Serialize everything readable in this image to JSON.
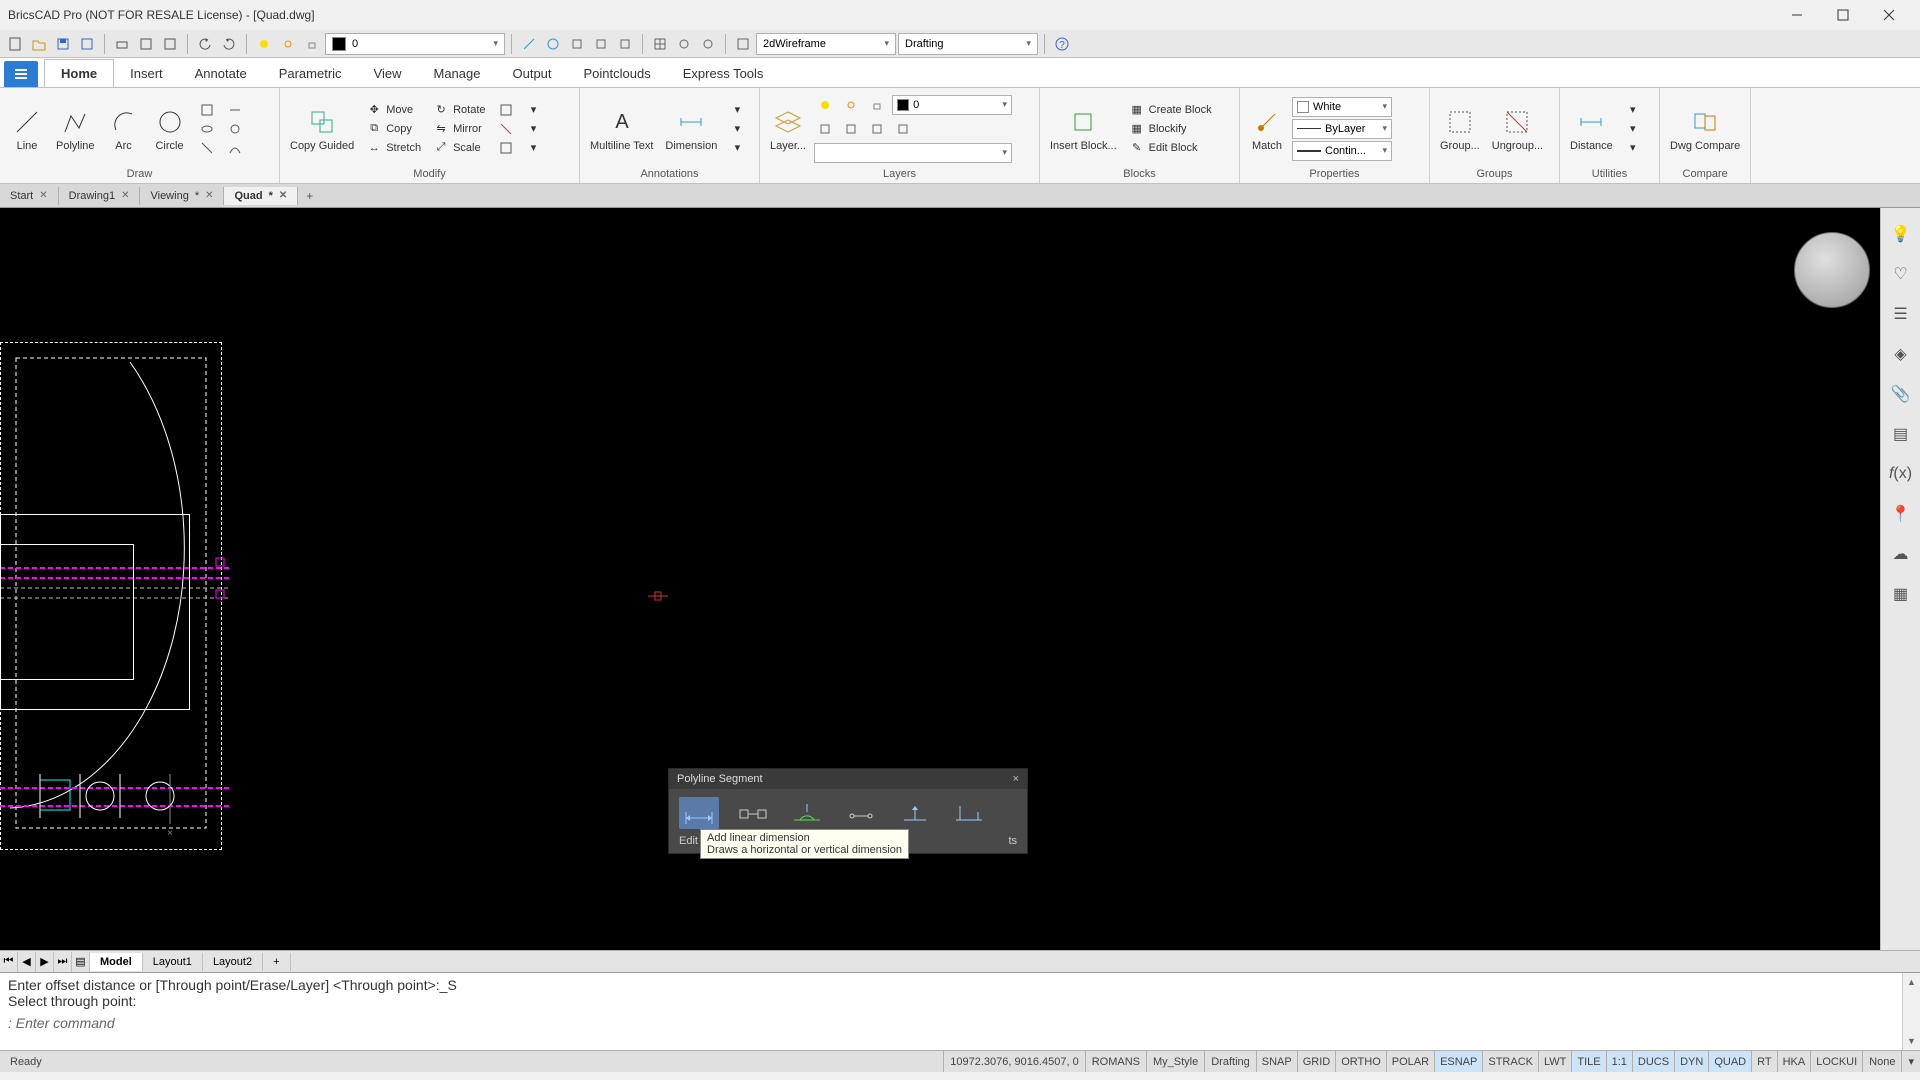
{
  "window": {
    "title": "BricsCAD Pro (NOT FOR RESALE License) - [Quad.dwg]"
  },
  "qat": {
    "layer_combo": "0",
    "visual_style": "2dWireframe",
    "workspace": "Drafting"
  },
  "ribbon_tabs": [
    "Home",
    "Insert",
    "Annotate",
    "Parametric",
    "View",
    "Manage",
    "Output",
    "Pointclouds",
    "Express Tools"
  ],
  "ribbon": {
    "draw": {
      "title": "Draw",
      "line": "Line",
      "polyline": "Polyline",
      "arc": "Arc",
      "circle": "Circle"
    },
    "modify": {
      "title": "Modify",
      "copy_guided": "Copy Guided",
      "move": "Move",
      "rotate": "Rotate",
      "copy": "Copy",
      "mirror": "Mirror",
      "stretch": "Stretch",
      "scale": "Scale"
    },
    "annotations": {
      "title": "Annotations",
      "mtext": "Multiline Text",
      "dimension": "Dimension"
    },
    "layers": {
      "title": "Layers",
      "button": "Layer...",
      "combo": "0"
    },
    "blocks": {
      "title": "Blocks",
      "insert": "Insert Block...",
      "create": "Create Block",
      "blockify": "Blockify",
      "edit": "Edit Block"
    },
    "properties": {
      "title": "Properties",
      "match": "Match",
      "color": "White",
      "linetype": "ByLayer",
      "lineweight": "Contin..."
    },
    "groups": {
      "title": "Groups",
      "group": "Group...",
      "ungroup": "Ungroup..."
    },
    "utilities": {
      "title": "Utilities",
      "distance": "Distance"
    },
    "compare": {
      "title": "Compare",
      "dwg": "Dwg Compare"
    }
  },
  "doc_tabs": [
    {
      "label": "Start",
      "active": false,
      "dirty": false
    },
    {
      "label": "Drawing1",
      "active": false,
      "dirty": false
    },
    {
      "label": "Viewing",
      "active": false,
      "dirty": true
    },
    {
      "label": "Quad",
      "active": true,
      "dirty": true
    }
  ],
  "quad": {
    "title": "Polyline Segment",
    "footer_left": "Edit",
    "footer_right": "ts",
    "tooltip_title": "Add linear dimension",
    "tooltip_desc": "Draws a horizontal or vertical dimension"
  },
  "layout_tabs": [
    "Model",
    "Layout1",
    "Layout2"
  ],
  "cmd": {
    "line1": "Enter offset distance or [Through point/Erase/Layer] <Through point>:_S",
    "line2": "Select through point:",
    "prompt": ": Enter command"
  },
  "status": {
    "ready": "Ready",
    "coords": "10972.3076, 9016.4507, 0",
    "textstyle": "ROMANS",
    "dimstyle": "My_Style",
    "workspace": "Drafting",
    "toggles": [
      "SNAP",
      "GRID",
      "ORTHO",
      "POLAR",
      "ESNAP",
      "STRACK",
      "LWT",
      "TILE",
      "1:1",
      "DUCS",
      "DYN",
      "QUAD",
      "RT",
      "HKA",
      "LOCKUI"
    ],
    "toggles_on": [
      "ESNAP",
      "TILE",
      "1:1",
      "DUCS",
      "DYN",
      "QUAD"
    ],
    "annoscale": "None"
  }
}
